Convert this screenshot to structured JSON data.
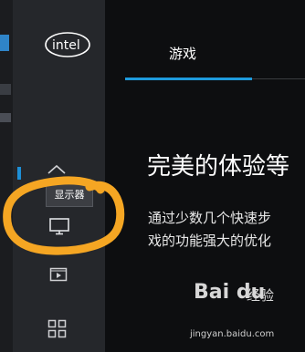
{
  "sidebar": {
    "logo_text": "intel",
    "tooltip": "显示器",
    "items": [
      {
        "icon": "home-icon"
      },
      {
        "icon": "monitor-icon"
      },
      {
        "icon": "video-icon"
      },
      {
        "icon": "grid-icon"
      }
    ]
  },
  "main": {
    "tab_label": "游戏",
    "headline": "完美的体验等",
    "description_line1": "通过少数几个快速步",
    "description_line2": "戏的功能强大的优化"
  },
  "watermark": {
    "brand": "Bai du",
    "brand_suffix": "经验",
    "url": "jingyan.baidu.com"
  },
  "colors": {
    "accent": "#1e9bdd",
    "annotation": "#f5a623",
    "sidebar_bg": "#25272b",
    "main_bg": "#0d0e10"
  }
}
